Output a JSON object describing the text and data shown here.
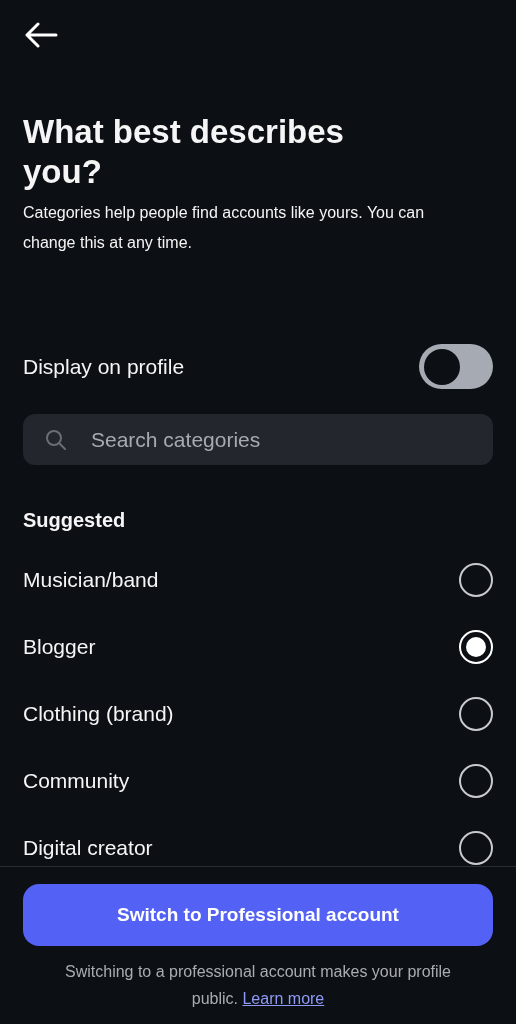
{
  "header": {
    "title": "What best describes you?",
    "subtitle": "Categories help people find accounts like yours. You can change this at any time."
  },
  "display_on_profile": {
    "label": "Display on profile",
    "on": false
  },
  "search": {
    "placeholder": "Search categories"
  },
  "section_title": "Suggested",
  "categories": [
    {
      "label": "Musician/band",
      "selected": false
    },
    {
      "label": "Blogger",
      "selected": true
    },
    {
      "label": "Clothing (brand)",
      "selected": false
    },
    {
      "label": "Community",
      "selected": false
    },
    {
      "label": "Digital creator",
      "selected": false
    }
  ],
  "footer": {
    "button": "Switch to Professional account",
    "note": "Switching to a professional account makes your profile public.",
    "link": "Learn more"
  }
}
